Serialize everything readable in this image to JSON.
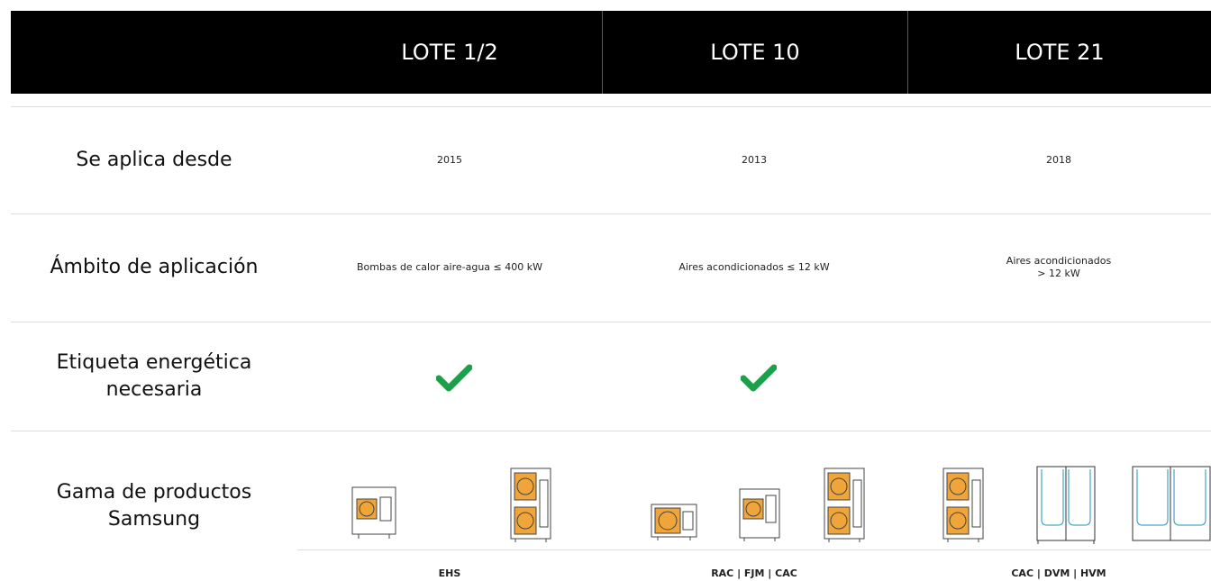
{
  "header": {
    "columns": [
      "LOTE 1/2",
      "LOTE 10",
      "LOTE 21"
    ]
  },
  "rows": {
    "applies_since": {
      "label": "Se aplica desde",
      "values": [
        "2015",
        "2013",
        "2018"
      ]
    },
    "scope": {
      "label": "Ámbito de aplicación",
      "values": [
        "Bombas de calor aire-agua ≤ 400 kW",
        "Aires acondicionados ≤ 12 kW",
        "Aires acondicionados\n> 12 kW"
      ]
    },
    "energy_label": {
      "label": "Etiqueta energética necesaria",
      "values": [
        true,
        true,
        false
      ]
    },
    "product_range": {
      "label": "Gama de productos Samsung",
      "groups": [
        "EHS",
        "RAC | FJM | CAC",
        "CAC | DVM | HVM"
      ]
    }
  },
  "colors": {
    "header_bg": "#000000",
    "check_green": "#1aa14a",
    "fan_orange": "#f0a53a",
    "vrf_blue": "#4aa3c8"
  },
  "icons": [
    "check-icon",
    "outdoor-unit-icon",
    "vrf-unit-icon"
  ]
}
